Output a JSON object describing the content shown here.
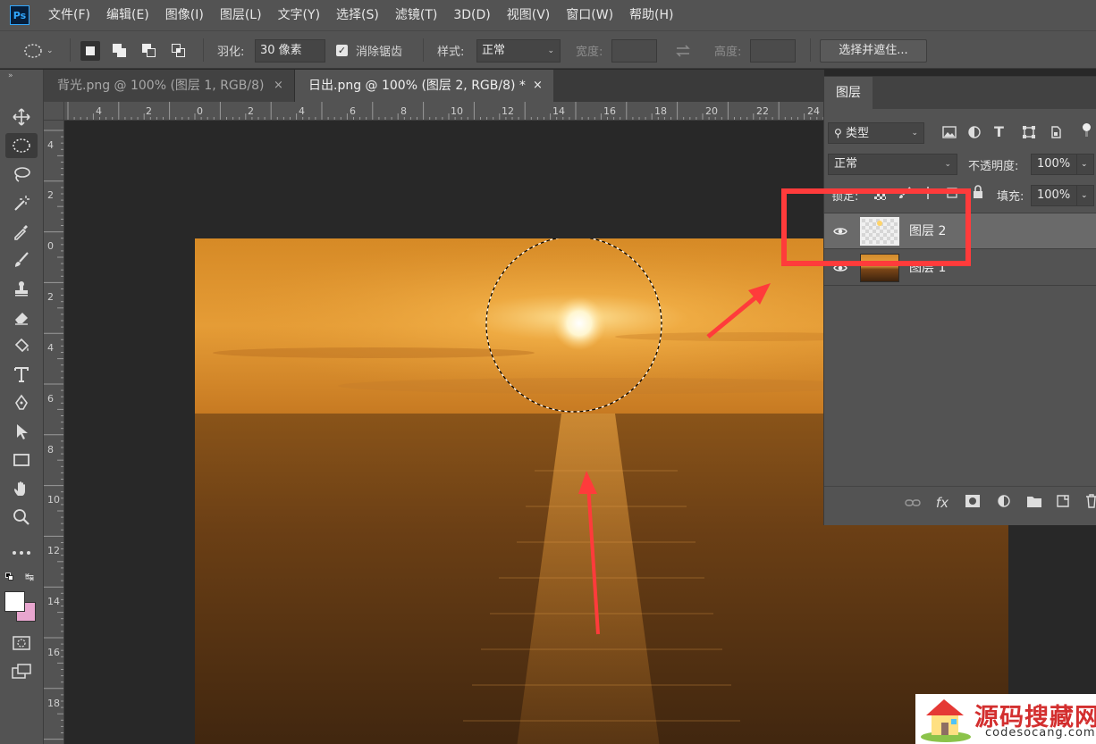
{
  "app": {
    "logo": "Ps"
  },
  "menu": [
    "文件(F)",
    "编辑(E)",
    "图像(I)",
    "图层(L)",
    "文字(Y)",
    "选择(S)",
    "滤镜(T)",
    "3D(D)",
    "视图(V)",
    "窗口(W)",
    "帮助(H)"
  ],
  "options": {
    "feather_label": "羽化:",
    "feather_value": "30 像素",
    "antialias_label": "消除锯齿",
    "antialias_checked": true,
    "style_label": "样式:",
    "style_value": "正常",
    "width_label": "宽度:",
    "width_value": "",
    "height_label": "高度:",
    "height_value": "",
    "refine_button": "选择并遮住..."
  },
  "tabs": [
    {
      "label": "背光.png @ 100% (图层 1, RGB/8)",
      "close": "×",
      "active": false
    },
    {
      "label": "日出.png @ 100% (图层 2, RGB/8) *",
      "close": "×",
      "active": true
    }
  ],
  "ruler": {
    "top": [
      "4",
      "2",
      "0",
      "2",
      "4",
      "6",
      "8",
      "10",
      "12",
      "14",
      "16",
      "18",
      "20",
      "22",
      "24"
    ],
    "left": [
      "4",
      "2",
      "0",
      "2",
      "4",
      "6",
      "8",
      "10",
      "12",
      "14",
      "16",
      "18"
    ]
  },
  "layers_panel": {
    "tab": "图层",
    "filter_value": "类型",
    "blend_mode": "正常",
    "opacity_label": "不透明度:",
    "opacity_value": "100%",
    "lock_label": "锁定:",
    "fill_label": "填充:",
    "fill_value": "100%",
    "layers": [
      {
        "name": "图层 2",
        "visible": true,
        "selected": true
      },
      {
        "name": "图层 1",
        "visible": true,
        "selected": false
      }
    ],
    "footer_fx": "fx"
  },
  "colors": {
    "foreground": "#ffffff",
    "background": "#e8a6cf",
    "annotation": "#ff3b3b"
  },
  "watermark": {
    "title": "源码搜藏网",
    "url": "codesocang.com"
  }
}
